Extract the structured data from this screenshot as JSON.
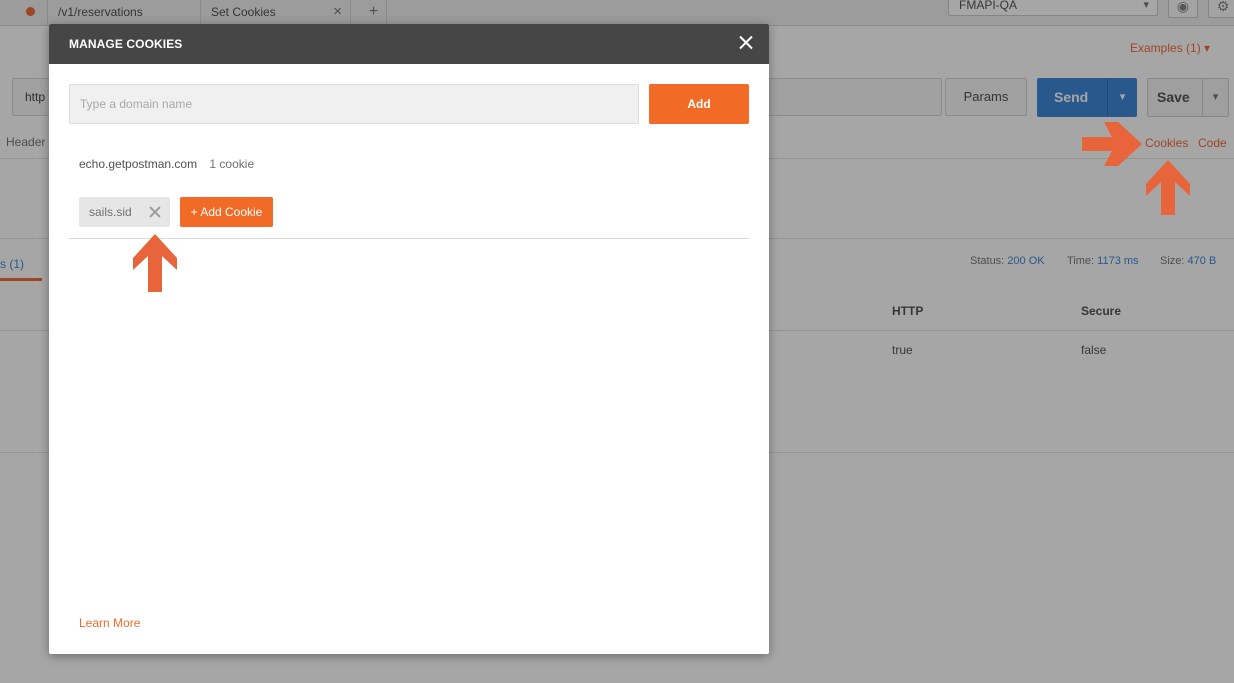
{
  "tabs": [
    {
      "label": "/v1/reservations"
    },
    {
      "label": "Set Cookies",
      "close": "×"
    }
  ],
  "tab_add": "+",
  "environment": {
    "selected": "FMAPI-QA"
  },
  "examples_label": "Examples (1) ▾",
  "request": {
    "url_prefix": "http",
    "params_label": "Params",
    "send_label": "Send",
    "save_label": "Save",
    "headers_label": "Header",
    "cookies_link": "Cookies",
    "code_link": "Code"
  },
  "response": {
    "tab_label": "s (1)",
    "status_label": "Status:",
    "status_value": "200 OK",
    "time_label": "Time:",
    "time_value": "1173 ms",
    "size_label": "Size:",
    "size_value": "470 B",
    "columns": [
      "HTTP",
      "Secure"
    ],
    "row": [
      "true",
      "false"
    ]
  },
  "modal": {
    "title": "MANAGE COOKIES",
    "domain_placeholder": "Type a domain name",
    "add_label": "Add",
    "domain": "echo.getpostman.com",
    "domain_count": "1 cookie",
    "cookie_name": "sails.sid",
    "add_cookie_label": "+ Add Cookie",
    "learn_more": "Learn More"
  },
  "colors": {
    "accent": "#f26b26",
    "send_blue": "#3f87d9",
    "header_bg": "#464646",
    "arrow": "#e8643a"
  }
}
